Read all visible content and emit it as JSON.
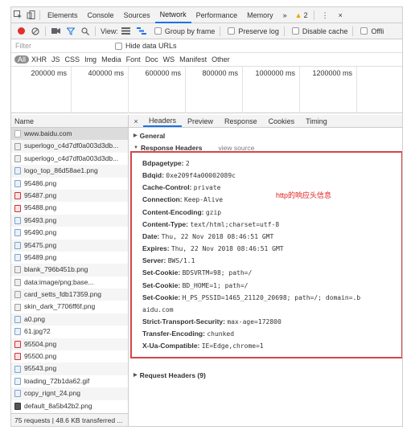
{
  "topbar": {
    "tabs": [
      "Elements",
      "Console",
      "Sources",
      "Network",
      "Performance",
      "Memory"
    ],
    "active_tab": "Network",
    "more_label": "»",
    "warning_count": "2",
    "menu_label": "⋮",
    "close_label": "×"
  },
  "toolbar": {
    "view_label": "View:",
    "group_by_frame": "Group by frame",
    "preserve_log": "Preserve log",
    "disable_cache": "Disable cache",
    "offline": "Offli"
  },
  "filter": {
    "placeholder": "Filter",
    "hide_data_urls": "Hide data URLs"
  },
  "types": [
    "All",
    "XHR",
    "JS",
    "CSS",
    "Img",
    "Media",
    "Font",
    "Doc",
    "WS",
    "Manifest",
    "Other"
  ],
  "timeline": {
    "labels": [
      "200000 ms",
      "400000 ms",
      "600000 ms",
      "800000 ms",
      "1000000 ms",
      "1200000 ms"
    ]
  },
  "requests": {
    "header": "Name",
    "items": [
      "www.baidu.com",
      "superlogo_c4d7df0a003d3db...",
      "superlogo_c4d7df0a003d3db...",
      "logo_top_86d58ae1.png",
      "95486.png",
      "95487.png",
      "95488.png",
      "95493.png",
      "95490.png",
      "95475.png",
      "95489.png",
      "blank_796b451b.png",
      "data:image/png;base...",
      "card_setts_fdb17359.png",
      "skin_dark_7706ff6f.png",
      "a0.png",
      "61.jpg?2",
      "95504.png",
      "95500.png",
      "95543.png",
      "loading_72b1da62.gif",
      "copy_rignt_24.png",
      "default_8a5b42b2.png"
    ],
    "status": "75 requests | 48.6 KB transferred ..."
  },
  "details": {
    "close": "×",
    "tabs": [
      "Headers",
      "Preview",
      "Response",
      "Cookies",
      "Timing"
    ],
    "active_tab": "Headers",
    "general": "General",
    "response_headers": "Response Headers",
    "view_source": "view source",
    "request_headers": "Request Headers (9)",
    "headers": [
      {
        "key": "Bdpagetype:",
        "value": "2"
      },
      {
        "key": "Bdqid:",
        "value": "0xe209f4a00002089c"
      },
      {
        "key": "Cache-Control:",
        "value": "private"
      },
      {
        "key": "Connection:",
        "value": "Keep-Alive"
      },
      {
        "key": "Content-Encoding:",
        "value": "gzip"
      },
      {
        "key": "Content-Type:",
        "value": "text/html;charset=utf-8"
      },
      {
        "key": "Date:",
        "value": "Thu, 22 Nov 2018 08:46:51 GMT"
      },
      {
        "key": "Expires:",
        "value": "Thu, 22 Nov 2018 08:46:51 GMT"
      },
      {
        "key": "Server:",
        "value": "BWS/1.1"
      },
      {
        "key": "Set-Cookie:",
        "value": "BDSVRTM=98; path=/"
      },
      {
        "key": "Set-Cookie:",
        "value": "BD_HOME=1; path=/"
      },
      {
        "key": "Set-Cookie:",
        "value": "H_PS_PSSID=1465_21120_20698; path=/; domain=.b"
      },
      {
        "key": "",
        "value": "aidu.com"
      },
      {
        "key": "Strict-Transport-Security:",
        "value": "max-age=172800"
      },
      {
        "key": "Transfer-Encoding:",
        "value": "chunked"
      },
      {
        "key": "X-Ua-Compatible:",
        "value": "IE=Edge,chrome=1"
      }
    ],
    "annotation": "http的响应头信息"
  },
  "colors": {
    "record": "#e0312b",
    "accent": "#1a73e8",
    "annotation": "#e02020",
    "highlight_box": "#d64545",
    "warning": "#f2a600"
  }
}
